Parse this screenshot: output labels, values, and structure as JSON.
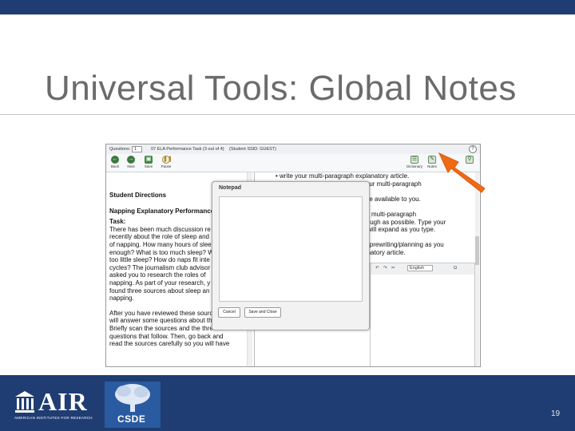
{
  "slide": {
    "title": "Universal Tools: Global Notes",
    "page_number": "19"
  },
  "test_app": {
    "question_bar": {
      "questions_label": "Questions:",
      "question_value": "1",
      "test_title": "07 ELA Performance Task (3 out of 4)",
      "student": "(Student SSID: GUEST)",
      "help": "?"
    },
    "toolbar": {
      "back": "Back",
      "next": "Next",
      "save": "Save",
      "pause": "Pause",
      "dictionary": "Dictionary",
      "notes": "Notes"
    },
    "left_pane": {
      "heading": "Student Directions",
      "subheading": "Napping Explanatory Performance",
      "task_label": "Task:",
      "paragraph1": [
        "There has been much discussion re",
        "recently about the role of sleep and",
        "of napping. How many hours of slee",
        "enough? What is too much sleep? W",
        "too little sleep? How do naps fit inte",
        "cycles? The journalism club advisor",
        "asked you to research the roles of",
        "napping. As part of your research, y",
        "found three sources about sleep an",
        "napping."
      ],
      "paragraph2": [
        "After you have reviewed these sources, you",
        "will answer some questions about them.",
        "Briefly scan the sources and the three",
        "questions that follow. Then, go back and",
        "read the sources carefully so you will have"
      ]
    },
    "right_pane": {
      "lines": [
        "write your multi-paragraph explanatory article.",
        "of your multi-paragraph",
        "",
        "ck are available to you.",
        "",
        "rite a multi-paragraph",
        "thorough as possible. Type your",
        "box will expand as you type.",
        "",
        "your prewriting/planning as you",
        "xplanatory article."
      ],
      "language": "English"
    },
    "notepad": {
      "title": "Notepad",
      "cancel": "Cancel",
      "save_close": "Save and Close"
    }
  },
  "footer": {
    "air_word": "AIR",
    "air_tagline": "AMERICAN INSTITUTES FOR RESEARCH",
    "csde_word": "CSDE"
  },
  "colors": {
    "brand_navy": "#1f3d73",
    "title_gray": "#6b6b6b",
    "arrow_orange": "#f06a14",
    "toolbar_green": "#3d7a3d"
  }
}
